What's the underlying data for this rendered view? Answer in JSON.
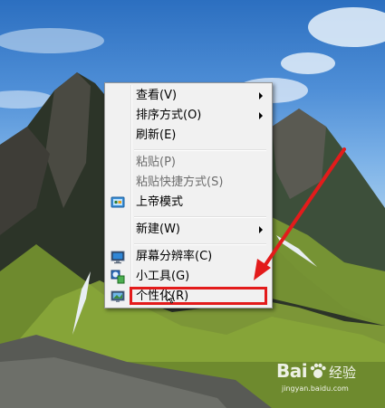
{
  "context_menu": {
    "items": [
      {
        "label": "查看(V)",
        "submenu": true,
        "enabled": true
      },
      {
        "label": "排序方式(O)",
        "submenu": true,
        "enabled": true
      },
      {
        "label": "刷新(E)",
        "enabled": true
      },
      {
        "label": "粘贴(P)",
        "enabled": false
      },
      {
        "label": "粘贴快捷方式(S)",
        "enabled": false
      },
      {
        "label": "上帝模式",
        "icon": "control-panel-icon",
        "enabled": true
      },
      {
        "label": "新建(W)",
        "submenu": true,
        "enabled": true
      },
      {
        "label": "屏幕分辨率(C)",
        "icon": "screen-resolution-icon",
        "enabled": true
      },
      {
        "label": "小工具(G)",
        "icon": "gadgets-icon",
        "enabled": true
      },
      {
        "label": "个性化(R)",
        "icon": "personalize-icon",
        "enabled": true,
        "highlighted": true
      }
    ]
  },
  "annotation": {
    "color": "#e31b1b"
  },
  "watermark": {
    "logo_text": "Bai",
    "logo_suffix": "经验",
    "url": "jingyan.baidu.com"
  }
}
